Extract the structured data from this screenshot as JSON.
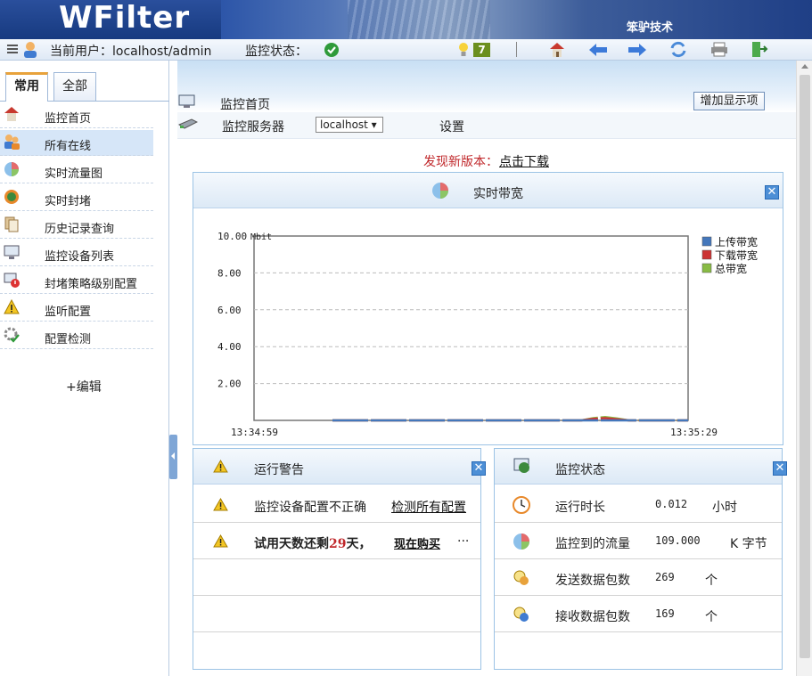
{
  "banner": {
    "logo": "WFilter",
    "company": "笨驴技术"
  },
  "toolbar": {
    "current_user_label": "当前用户：localhost/admin",
    "monitor_status_label": "监控状态：",
    "notify_count": "7"
  },
  "sidebar": {
    "tabs": [
      {
        "label": "常用"
      },
      {
        "label": "全部"
      }
    ],
    "items": [
      {
        "label": "监控首页"
      },
      {
        "label": "所有在线"
      },
      {
        "label": "实时流量图"
      },
      {
        "label": "实时封堵"
      },
      {
        "label": "历史记录查询"
      },
      {
        "label": "监控设备列表"
      },
      {
        "label": "封堵策略级别配置"
      },
      {
        "label": "监听配置"
      },
      {
        "label": "配置检测"
      }
    ],
    "edit_label": "+编辑"
  },
  "main": {
    "page_title": "监控首页",
    "add_display_button": "增加显示项",
    "server_label": "监控服务器",
    "server_select_value": "localhost ▾",
    "settings_link": "设置",
    "new_version_prefix": "发现新版本：",
    "new_version_link": "点击下载"
  },
  "bandwidth_panel": {
    "title": "实时带宽",
    "close": "✕"
  },
  "chart_data": {
    "type": "line",
    "title": "",
    "ylabel": "Mbit",
    "ylim": [
      0,
      10
    ],
    "yticks": [
      "10.00",
      "8.00",
      "6.00",
      "4.00",
      "2.00"
    ],
    "x_start": "13:34:59",
    "x_end": "13:35:29",
    "grid": true,
    "legend_position": "right",
    "series": [
      {
        "name": "上传带宽",
        "color": "#4477bb",
        "values": [
          0,
          0,
          0,
          0,
          0,
          0,
          0,
          0,
          0,
          0,
          0,
          0,
          0,
          0,
          0,
          0,
          0,
          0,
          0,
          0,
          0,
          0,
          0,
          0,
          0,
          0,
          0,
          0,
          0,
          0,
          0
        ]
      },
      {
        "name": "下载带宽",
        "color": "#cc3333",
        "values": [
          0,
          0,
          0,
          0,
          0,
          0,
          0,
          0,
          0,
          0,
          0,
          0,
          0,
          0,
          0,
          0,
          0,
          0,
          0,
          0,
          0,
          0,
          0.08,
          0.12,
          0.06,
          0,
          0,
          0,
          0,
          0,
          0
        ]
      },
      {
        "name": "总带宽",
        "color": "#88bb44",
        "values": [
          0,
          0,
          0,
          0,
          0,
          0,
          0,
          0,
          0,
          0,
          0,
          0,
          0,
          0,
          0,
          0,
          0,
          0,
          0,
          0,
          0,
          0,
          0.12,
          0.18,
          0.1,
          0,
          0,
          0,
          0,
          0,
          0
        ]
      }
    ]
  },
  "alerts_panel": {
    "title": "运行警告",
    "close": "✕",
    "rows": [
      {
        "text": "监控设备配置不正确",
        "link": "检测所有配置"
      },
      {
        "text_prefix": "试用天数还剩",
        "days": "29",
        "text_suffix": "天，",
        "link": "现在购买",
        "more": "···"
      }
    ]
  },
  "status_panel": {
    "title": "监控状态",
    "close": "✕",
    "rows": [
      {
        "label": "运行时长",
        "value": "0.012",
        "unit": "小时"
      },
      {
        "label": "监控到的流量",
        "value": "109.000",
        "unit": "K 字节"
      },
      {
        "label": "发送数据包数",
        "value": "269",
        "unit": "个"
      },
      {
        "label": "接收数据包数",
        "value": "169",
        "unit": "个"
      }
    ]
  }
}
